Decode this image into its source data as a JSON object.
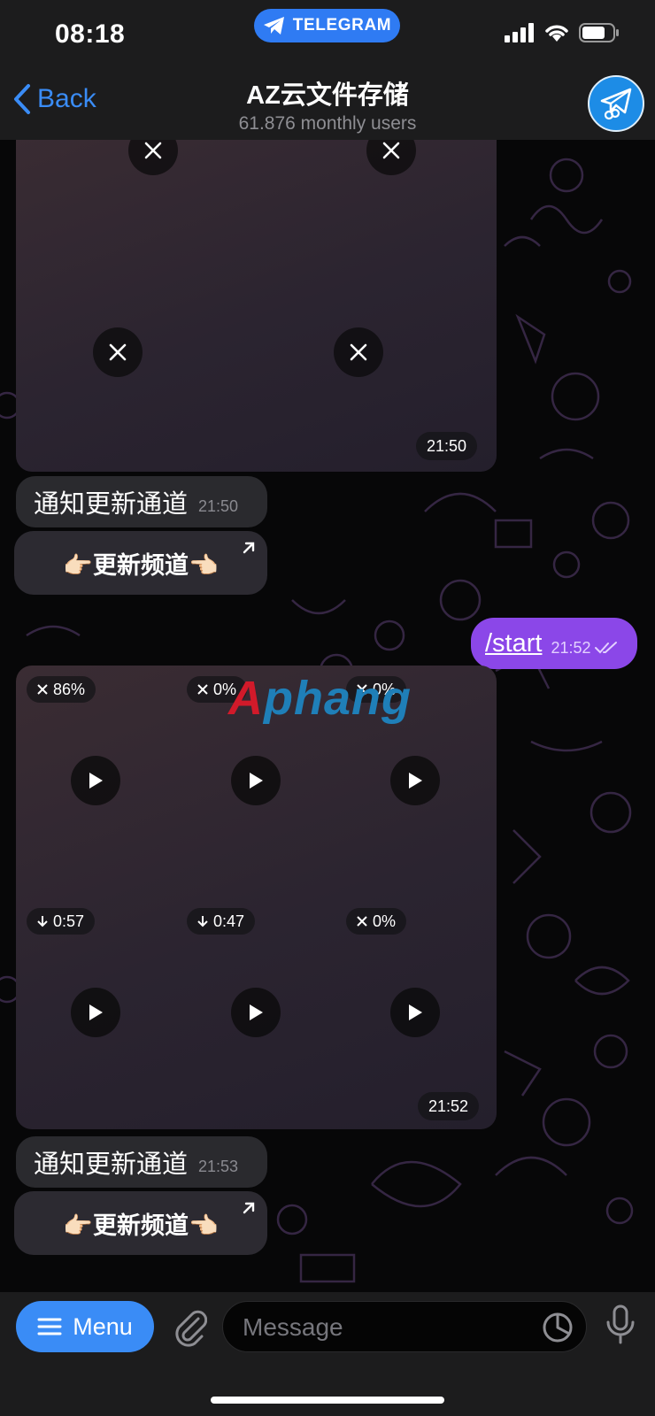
{
  "status_bar": {
    "time": "08:18",
    "app_pill": "TELEGRAM"
  },
  "header": {
    "back_label": "Back",
    "title": "AZ云文件存储",
    "subtitle": "61.876 monthly users"
  },
  "messages": {
    "album1": {
      "time": "21:50"
    },
    "text1": {
      "text": "通知更新通道",
      "time": "21:50"
    },
    "button1": {
      "label": "👉🏻更新频道👈🏻"
    },
    "outgoing": {
      "text": "/start",
      "time": "21:52"
    },
    "album2": {
      "time": "21:52",
      "badges": [
        "86%",
        "0%",
        "0%",
        "0:57",
        "0:47",
        "0%"
      ]
    },
    "text2": {
      "text": "通知更新通道",
      "time": "21:53"
    },
    "button2": {
      "label": "👉🏻更新频道👈🏻"
    }
  },
  "watermark": {
    "part1": "A",
    "part2": "phang"
  },
  "input_bar": {
    "menu_label": "Menu",
    "placeholder": "Message"
  },
  "colors": {
    "accent": "#3a8cf6",
    "outgoing_bubble": "#8b47e8",
    "header_bg": "#1c1c1d"
  }
}
